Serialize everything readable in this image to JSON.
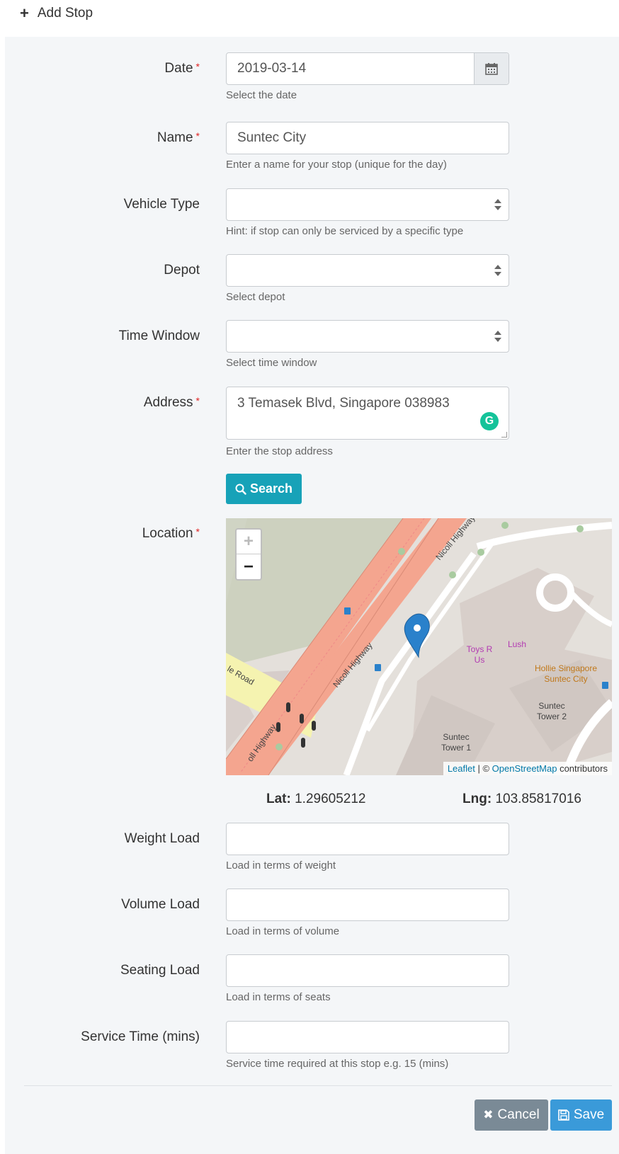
{
  "header": {
    "icon": "plus-icon",
    "title": "Add Stop"
  },
  "fields": {
    "date": {
      "label": "Date",
      "value": "2019-03-14",
      "help": "Select the date",
      "required": true
    },
    "name": {
      "label": "Name",
      "value": "Suntec City",
      "help": "Enter a name for your stop (unique for the day)",
      "required": true
    },
    "vehicle_type": {
      "label": "Vehicle Type",
      "value": "",
      "help": "Hint: if stop can only be serviced by a specific type"
    },
    "depot": {
      "label": "Depot",
      "value": "",
      "help": "Select depot"
    },
    "time_window": {
      "label": "Time Window",
      "value": "",
      "help": "Select time window"
    },
    "address": {
      "label": "Address",
      "value": "3 Temasek Blvd, Singapore 038983",
      "help": "Enter the stop address",
      "required": true
    },
    "weight_load": {
      "label": "Weight Load",
      "value": "",
      "help": "Load in terms of weight"
    },
    "volume_load": {
      "label": "Volume Load",
      "value": "",
      "help": "Load in terms of volume"
    },
    "seating_load": {
      "label": "Seating Load",
      "value": "",
      "help": "Load in terms of seats"
    },
    "service_time": {
      "label": "Service Time (mins)",
      "value": "",
      "help": "Service time required at this stop e.g. 15 (mins)"
    }
  },
  "search_button": {
    "label": "Search",
    "icon": "search-icon"
  },
  "location": {
    "label": "Location",
    "lat_label": "Lat:",
    "lat": "1.29605212",
    "lng_label": "Lng:",
    "lng": "103.85817016",
    "map": {
      "zoom_in": "+",
      "zoom_out": "−",
      "attribution_leaflet": "Leaflet",
      "attribution_sep": " | © ",
      "attribution_osm": "OpenStreetMap",
      "attribution_tail": " contributors",
      "labels": {
        "nicoll_1": "Nicoll Highway",
        "nicoll_2": "Nicoll Highway",
        "nicoll_3": "oll Highway",
        "road": "le Road",
        "toys": "Toys R Us",
        "lush": "Lush",
        "hollie": "Hollie Singapore Suntec City",
        "tower2": "Suntec Tower 2",
        "tower1": "Suntec Tower 1"
      }
    }
  },
  "actions": {
    "cancel": "Cancel",
    "save": "Save"
  },
  "colors": {
    "required": "#e02424",
    "search": "#17a2b8",
    "cancel": "#7a8a96",
    "save": "#3a9ad9",
    "road": "#f4a58f",
    "marker": "#2a81cb"
  }
}
